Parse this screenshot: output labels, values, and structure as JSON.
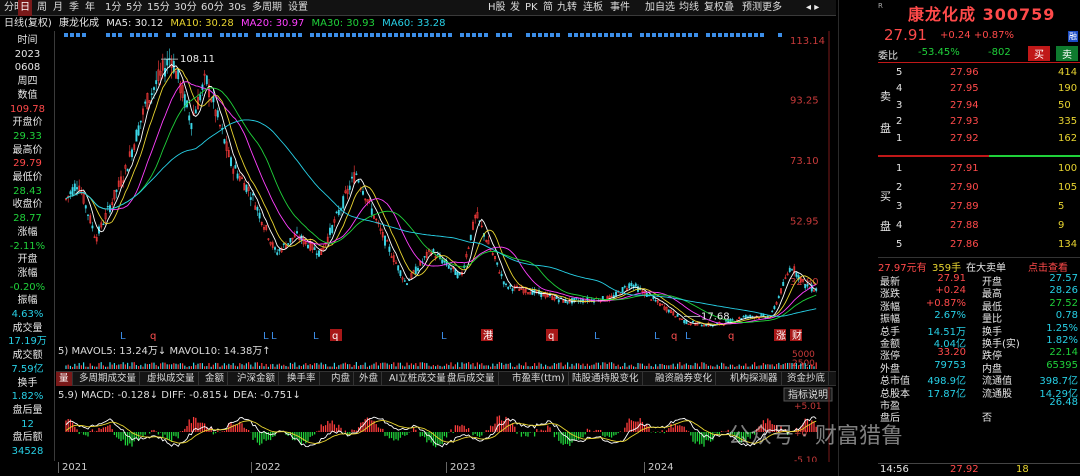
{
  "topbar": {
    "items": [
      "分时",
      "日",
      "周",
      "月",
      "季",
      "年",
      "1分",
      "5分",
      "15分",
      "30分",
      "60分",
      "30s",
      "多周期",
      "设置"
    ],
    "right_items": [
      "H股",
      "发",
      "PK",
      "简",
      "九转",
      "连板",
      "事件",
      "加自选",
      "均线",
      "复权",
      "叠",
      "预测",
      "更多"
    ]
  },
  "infobar": {
    "label": "日线(复权)",
    "stock": "康龙化成",
    "ma5": "MA5: 30.12",
    "ma10": "MA10: 30.28",
    "ma20": "MA20: 30.97",
    "ma30": "MA30: 30.93",
    "ma60": "MA60: 33.28"
  },
  "sidebar": [
    {
      "t": "时间",
      "c": "wht"
    },
    {
      "t": "2023",
      "c": "wht"
    },
    {
      "t": "0608",
      "c": "wht"
    },
    {
      "t": "周四",
      "c": "wht"
    },
    {
      "t": "数值",
      "c": "wht"
    },
    {
      "t": "109.78",
      "c": "red"
    },
    {
      "t": "开盘价",
      "c": "wht"
    },
    {
      "t": "29.33",
      "c": "green"
    },
    {
      "t": "最高价",
      "c": "wht"
    },
    {
      "t": "29.79",
      "c": "red"
    },
    {
      "t": "最低价",
      "c": "wht"
    },
    {
      "t": "28.43",
      "c": "green"
    },
    {
      "t": "收盘价",
      "c": "wht"
    },
    {
      "t": "28.77",
      "c": "green"
    },
    {
      "t": "涨幅",
      "c": "wht"
    },
    {
      "t": "-2.11%",
      "c": "green"
    },
    {
      "t": "开盘",
      "c": "wht"
    },
    {
      "t": "涨幅",
      "c": "wht"
    },
    {
      "t": "-0.20%",
      "c": "green"
    },
    {
      "t": "振幅",
      "c": "wht"
    },
    {
      "t": "4.63%",
      "c": "cyan"
    },
    {
      "t": "成交量",
      "c": "wht"
    },
    {
      "t": "17.19万",
      "c": "cyan"
    },
    {
      "t": "成交额",
      "c": "wht"
    },
    {
      "t": "7.59亿",
      "c": "cyan"
    },
    {
      "t": "换手",
      "c": "wht"
    },
    {
      "t": "1.82%",
      "c": "cyan"
    },
    {
      "t": "盘后量",
      "c": "wht"
    },
    {
      "t": "12",
      "c": "cyan"
    },
    {
      "t": "盘后额",
      "c": "wht"
    },
    {
      "t": "34528",
      "c": "cyan"
    }
  ],
  "chart": {
    "y_ticks": [
      "113.14",
      "93.25",
      "73.10",
      "52.95",
      "32.80",
      "12.65"
    ],
    "high_label": "108.11",
    "low_label": "17.68",
    "x_labels": [
      "2021",
      "2022",
      "2023",
      "2024"
    ],
    "markers": [
      "L",
      "q",
      "L",
      "L",
      "L",
      "q",
      "L",
      "港",
      "q",
      "L",
      "L",
      "q",
      "L",
      "q",
      "涨",
      "财"
    ],
    "vol_info": "5) MAVOL5: 13.24万↓ MAVOL10: 14.38万↑",
    "vol_ticks": [
      "5000",
      "2500"
    ],
    "macd_info": "5.9) MACD: -0.128↓ DIFF: -0.815↓ DEA: -0.751↓",
    "macd_ticks": [
      "+5.01",
      "+0",
      "-5.10"
    ],
    "macd_btn": "指标说明",
    "tabs": [
      "量",
      "多周期成交量",
      "虚拟成交量",
      "金额",
      "沪深金额",
      "换手率",
      "内盘",
      "外盘",
      "AI立桩成交量",
      "盘后成交量",
      "市盈率(ttm)",
      "陆股通持股变化",
      "融资融券变化",
      "机构探测器",
      "资金抄底"
    ]
  },
  "quote": {
    "name": "康龙化成",
    "code": "300759",
    "price": "27.91",
    "change": "+0.24",
    "pct": "+0.87%",
    "tag": "融",
    "weibi_label": "委比",
    "weibi": "-53.45%",
    "weicha": "-802",
    "buy_btn": "买",
    "sell_btn": "卖",
    "sell": [
      {
        "n": "5",
        "p": "27.96",
        "v": "414"
      },
      {
        "n": "4",
        "p": "27.95",
        "v": "190"
      },
      {
        "n": "3",
        "p": "27.94",
        "v": "50"
      },
      {
        "n": "2",
        "p": "27.93",
        "v": "335"
      },
      {
        "n": "1",
        "p": "27.92",
        "v": "162"
      }
    ],
    "buy": [
      {
        "n": "1",
        "p": "27.91",
        "v": "100"
      },
      {
        "n": "2",
        "p": "27.90",
        "v": "105"
      },
      {
        "n": "3",
        "p": "27.89",
        "v": "5"
      },
      {
        "n": "4",
        "p": "27.88",
        "v": "9"
      },
      {
        "n": "5",
        "p": "27.86",
        "v": "134"
      }
    ],
    "sell_label": [
      "卖",
      "盘"
    ],
    "buy_label": [
      "买",
      "盘"
    ],
    "bigline": {
      "price": "27.97元有",
      "qty": "359手",
      "txt": "在大卖单",
      "link": "点击查看"
    },
    "stats": [
      [
        "最新",
        "27.91",
        "开盘",
        "27.57"
      ],
      [
        "涨跌",
        "+0.24",
        "最高",
        "28.26"
      ],
      [
        "涨幅",
        "+0.87%",
        "最低",
        "27.52"
      ],
      [
        "振幅",
        "2.67%",
        "量比",
        "0.78"
      ],
      [
        "总手",
        "14.51万",
        "换手",
        "1.25%"
      ],
      [
        "金额",
        "4.04亿",
        "换手(实)",
        "1.82%"
      ],
      [
        "涨停",
        "33.20",
        "跌停",
        "22.14"
      ],
      [
        "外盘",
        "79753",
        "内盘",
        "65395"
      ],
      [
        "总市值",
        "498.9亿",
        "流通值",
        "398.7亿"
      ],
      [
        "总股本",
        "17.87亿",
        "流通股",
        "14.29亿"
      ],
      [
        "市盈",
        "",
        "",
        "26.48"
      ],
      [
        "盘后",
        "",
        "否",
        ""
      ]
    ],
    "bottom": {
      "time": "14:56",
      "price": "27.92",
      "vol": "18"
    }
  },
  "watermark": "公众号 · 财富猎鲁"
}
